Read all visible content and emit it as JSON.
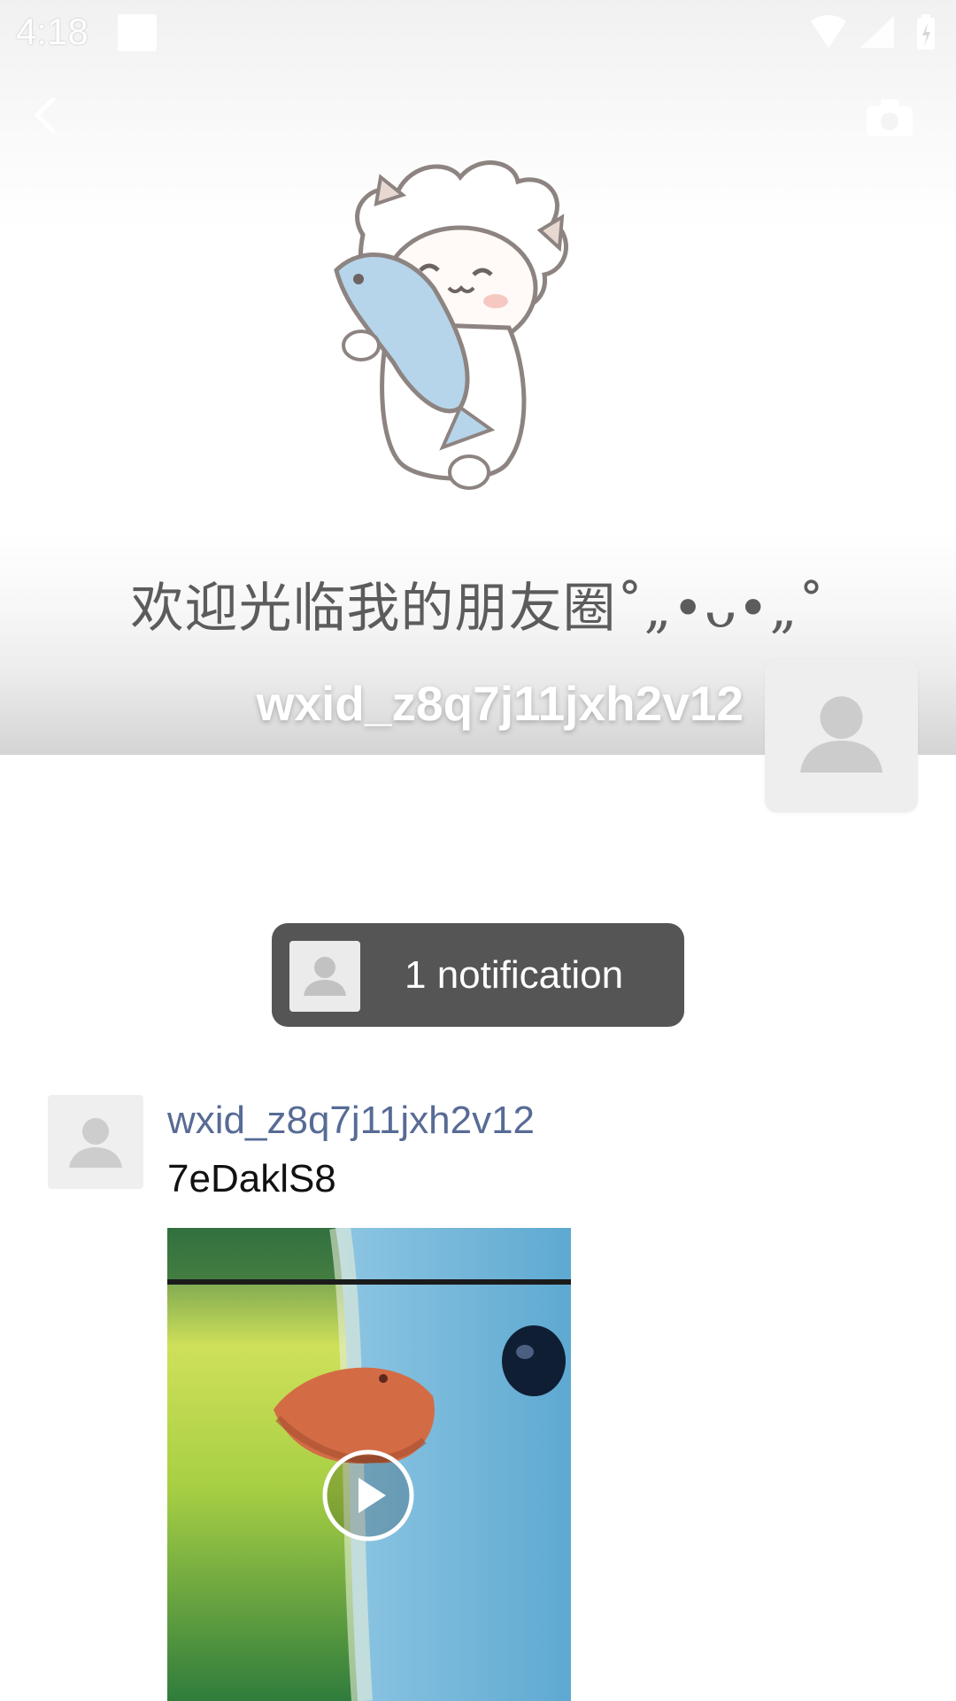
{
  "status_bar": {
    "time": "4:18"
  },
  "cover": {
    "caption": "欢迎光临我的朋友圈˚„•ᴗ•„˚"
  },
  "profile": {
    "name": "wxid_z8q7j11jxh2v12"
  },
  "notification": {
    "text": "1 notification"
  },
  "post": {
    "author": "wxid_z8q7j11jxh2v12",
    "text": "7eDaklS8"
  },
  "icons": {
    "back": "chevron-left-icon",
    "camera": "camera-icon",
    "play": "play-icon",
    "avatar_placeholder": "person-icon",
    "wifi": "wifi-icon",
    "signal": "signal-icon",
    "battery": "battery-icon"
  },
  "colors": {
    "link_blue": "#576b95",
    "pill_bg": "#555555",
    "placeholder_bg": "#eeeeee"
  }
}
